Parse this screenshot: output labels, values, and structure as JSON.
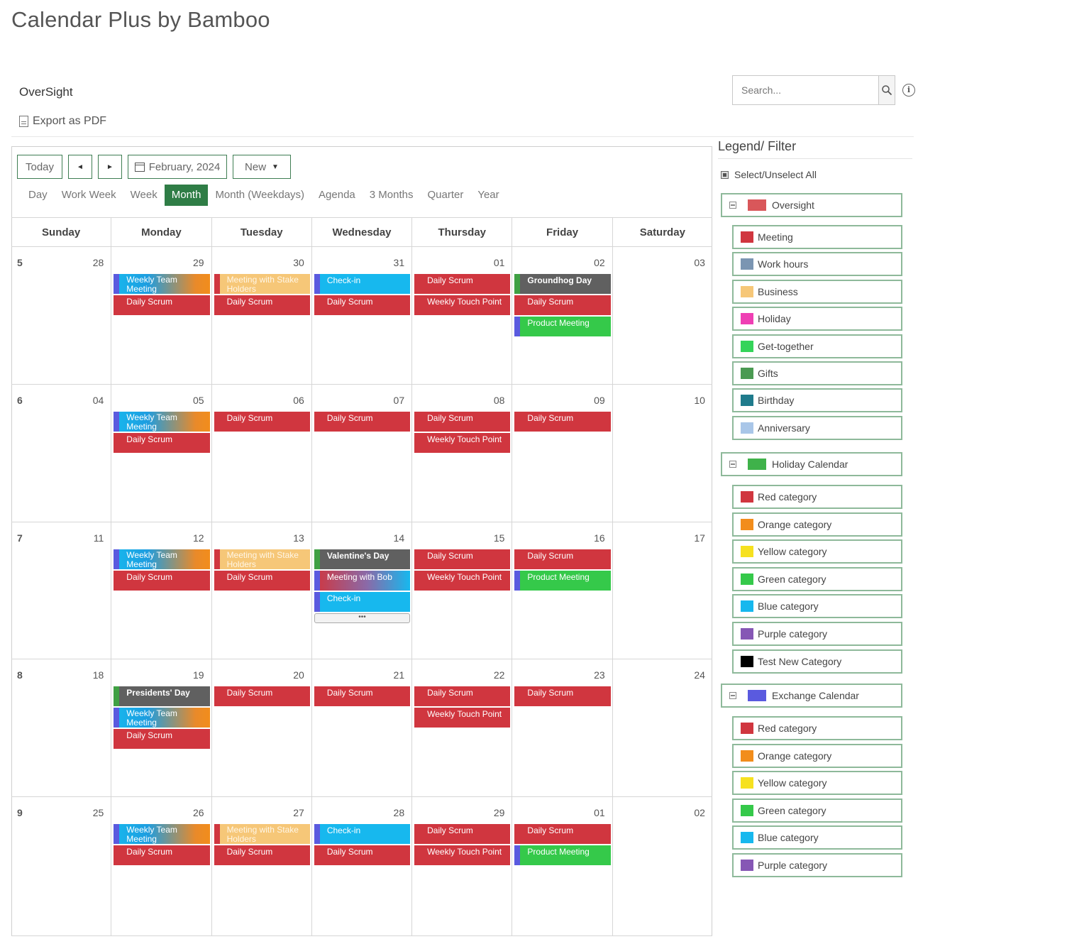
{
  "app": {
    "title": "Calendar Plus by Bamboo"
  },
  "section": {
    "name": "OverSight",
    "export_label": "Export as PDF"
  },
  "search": {
    "placeholder": "Search..."
  },
  "toolbar": {
    "today": "Today",
    "prev": "◄",
    "next": "►",
    "date": "February, 2024",
    "new": "New"
  },
  "views": [
    "Day",
    "Work Week",
    "Week",
    "Month",
    "Month (Weekdays)",
    "Agenda",
    "3 Months",
    "Quarter",
    "Year"
  ],
  "active_view": "Month",
  "weekdays": [
    "Sunday",
    "Monday",
    "Tuesday",
    "Wednesday",
    "Thursday",
    "Friday",
    "Saturday"
  ],
  "weeks": [
    {
      "num": "5",
      "days": [
        {
          "d": "28",
          "events": []
        },
        {
          "d": "29",
          "events": [
            {
              "t": "Weekly Team Meeting",
              "c": "grad-team"
            },
            {
              "t": "Daily Scrum",
              "c": "red"
            }
          ]
        },
        {
          "d": "30",
          "events": [
            {
              "t": "Meeting with Stake Holders",
              "c": "grad-stake"
            },
            {
              "t": "Daily Scrum",
              "c": "red"
            }
          ]
        },
        {
          "d": "31",
          "events": [
            {
              "t": "Check-in",
              "c": "cyan"
            },
            {
              "t": "Daily Scrum",
              "c": "red"
            }
          ]
        },
        {
          "d": "01",
          "events": [
            {
              "t": "Daily Scrum",
              "c": "red"
            },
            {
              "t": "Weekly Touch Point",
              "c": "red"
            }
          ]
        },
        {
          "d": "02",
          "events": [
            {
              "t": "Groundhog Day",
              "c": "gray"
            },
            {
              "t": "Daily Scrum",
              "c": "red"
            },
            {
              "t": "Product Meeting",
              "c": "green"
            }
          ]
        },
        {
          "d": "03",
          "events": []
        }
      ]
    },
    {
      "num": "6",
      "days": [
        {
          "d": "04",
          "events": []
        },
        {
          "d": "05",
          "events": [
            {
              "t": "Weekly Team Meeting",
              "c": "grad-team"
            },
            {
              "t": "Daily Scrum",
              "c": "red"
            }
          ]
        },
        {
          "d": "06",
          "events": [
            {
              "t": "Daily Scrum",
              "c": "red"
            }
          ]
        },
        {
          "d": "07",
          "events": [
            {
              "t": "Daily Scrum",
              "c": "red"
            }
          ]
        },
        {
          "d": "08",
          "events": [
            {
              "t": "Daily Scrum",
              "c": "red"
            },
            {
              "t": "Weekly Touch Point",
              "c": "red"
            }
          ]
        },
        {
          "d": "09",
          "events": [
            {
              "t": "Daily Scrum",
              "c": "red"
            }
          ]
        },
        {
          "d": "10",
          "events": []
        }
      ]
    },
    {
      "num": "7",
      "days": [
        {
          "d": "11",
          "events": []
        },
        {
          "d": "12",
          "events": [
            {
              "t": "Weekly Team Meeting",
              "c": "grad-team"
            },
            {
              "t": "Daily Scrum",
              "c": "red"
            }
          ]
        },
        {
          "d": "13",
          "events": [
            {
              "t": "Meeting with Stake Holders",
              "c": "grad-stake"
            },
            {
              "t": "Daily Scrum",
              "c": "red"
            }
          ]
        },
        {
          "d": "14",
          "events": [
            {
              "t": "Valentine's Day",
              "c": "gray"
            },
            {
              "t": "Meeting with Bob",
              "c": "grad-bob"
            },
            {
              "t": "Check-in",
              "c": "cyan"
            }
          ],
          "more": "•••"
        },
        {
          "d": "15",
          "events": [
            {
              "t": "Daily Scrum",
              "c": "red"
            },
            {
              "t": "Weekly Touch Point",
              "c": "red"
            }
          ]
        },
        {
          "d": "16",
          "events": [
            {
              "t": "Daily Scrum",
              "c": "red"
            },
            {
              "t": "Product Meeting",
              "c": "green"
            }
          ]
        },
        {
          "d": "17",
          "events": []
        }
      ]
    },
    {
      "num": "8",
      "days": [
        {
          "d": "18",
          "events": []
        },
        {
          "d": "19",
          "events": [
            {
              "t": "Presidents' Day",
              "c": "gray"
            },
            {
              "t": "Weekly Team Meeting",
              "c": "grad-team"
            },
            {
              "t": "Daily Scrum",
              "c": "red"
            }
          ]
        },
        {
          "d": "20",
          "events": [
            {
              "t": "Daily Scrum",
              "c": "red"
            }
          ]
        },
        {
          "d": "21",
          "events": [
            {
              "t": "Daily Scrum",
              "c": "red"
            }
          ]
        },
        {
          "d": "22",
          "events": [
            {
              "t": "Daily Scrum",
              "c": "red"
            },
            {
              "t": "Weekly Touch Point",
              "c": "red"
            }
          ]
        },
        {
          "d": "23",
          "events": [
            {
              "t": "Daily Scrum",
              "c": "red"
            }
          ]
        },
        {
          "d": "24",
          "events": []
        }
      ]
    },
    {
      "num": "9",
      "days": [
        {
          "d": "25",
          "events": []
        },
        {
          "d": "26",
          "events": [
            {
              "t": "Weekly Team Meeting",
              "c": "grad-team"
            },
            {
              "t": "Daily Scrum",
              "c": "red"
            }
          ]
        },
        {
          "d": "27",
          "events": [
            {
              "t": "Meeting with Stake Holders",
              "c": "grad-stake"
            },
            {
              "t": "Daily Scrum",
              "c": "red"
            }
          ]
        },
        {
          "d": "28",
          "events": [
            {
              "t": "Check-in",
              "c": "cyan"
            },
            {
              "t": "Daily Scrum",
              "c": "red"
            }
          ]
        },
        {
          "d": "29",
          "events": [
            {
              "t": "Daily Scrum",
              "c": "red"
            },
            {
              "t": "Weekly Touch Point",
              "c": "red"
            }
          ]
        },
        {
          "d": "01",
          "events": [
            {
              "t": "Daily Scrum",
              "c": "red"
            },
            {
              "t": "Product Meeting",
              "c": "green"
            }
          ]
        },
        {
          "d": "02",
          "events": []
        }
      ]
    }
  ],
  "legend": {
    "title": "Legend/ Filter",
    "select_all": "Select/Unselect All",
    "groups": [
      {
        "name": "Oversight",
        "color": "#d9575a",
        "items": [
          {
            "label": "Meeting",
            "color": "#d0363f"
          },
          {
            "label": "Work hours",
            "color": "#7b95b2"
          },
          {
            "label": "Business",
            "color": "#f6c778"
          },
          {
            "label": "Holiday",
            "color": "#ef3fb4"
          },
          {
            "label": "Get-together",
            "color": "#35d45a"
          },
          {
            "label": "Gifts",
            "color": "#4a9a52"
          },
          {
            "label": "Birthday",
            "color": "#1f7b8c"
          },
          {
            "label": "Anniversary",
            "color": "#a9c6e8"
          }
        ]
      },
      {
        "name": "Holiday Calendar",
        "color": "#3fb24a",
        "items": [
          {
            "label": "Red category",
            "color": "#d0363f"
          },
          {
            "label": "Orange category",
            "color": "#f28d1c"
          },
          {
            "label": "Yellow category",
            "color": "#f6e11f"
          },
          {
            "label": "Green category",
            "color": "#35c94a"
          },
          {
            "label": "Blue category",
            "color": "#17b8ee"
          },
          {
            "label": "Purple category",
            "color": "#8657b5"
          },
          {
            "label": "Test New Category",
            "color": "#000000"
          }
        ]
      },
      {
        "name": "Exchange Calendar",
        "color": "#5a5adf",
        "items": [
          {
            "label": "Red category",
            "color": "#d0363f"
          },
          {
            "label": "Orange category",
            "color": "#f28d1c"
          },
          {
            "label": "Yellow category",
            "color": "#f6e11f"
          },
          {
            "label": "Green category",
            "color": "#35c94a"
          },
          {
            "label": "Blue category",
            "color": "#17b8ee"
          },
          {
            "label": "Purple category",
            "color": "#8657b5"
          }
        ]
      }
    ]
  }
}
